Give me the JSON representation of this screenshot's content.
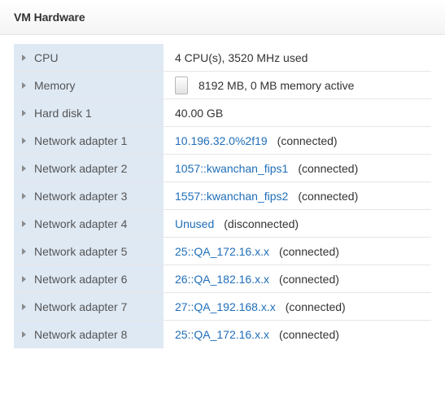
{
  "panel": {
    "title": "VM Hardware"
  },
  "rows": [
    {
      "label": "CPU",
      "value": "4 CPU(s), 3520 MHz used"
    },
    {
      "label": "Memory",
      "value": "8192 MB, 0 MB memory active",
      "memory_active_fraction": 0
    },
    {
      "label": "Hard disk 1",
      "value": "40.00 GB"
    },
    {
      "label": "Network adapter 1",
      "network": "10.196.32.0%2f19",
      "status": "(connected)"
    },
    {
      "label": "Network adapter 2",
      "network": "1057::kwanchan_fips1",
      "status": "(connected)"
    },
    {
      "label": "Network adapter 3",
      "network": "1557::kwanchan_fips2",
      "status": "(connected)"
    },
    {
      "label": "Network adapter 4",
      "network": "Unused",
      "status": "(disconnected)"
    },
    {
      "label": "Network adapter 5",
      "network": "25::QA_172.16.x.x",
      "status": "(connected)"
    },
    {
      "label": "Network adapter 6",
      "network": "26::QA_182.16.x.x",
      "status": "(connected)"
    },
    {
      "label": "Network adapter 7",
      "network": "27::QA_192.168.x.x",
      "status": "(connected)"
    },
    {
      "label": "Network adapter 8",
      "network": "25::QA_172.16.x.x",
      "status": "(connected)"
    }
  ],
  "colors": {
    "label_bg": "#dfe9f4",
    "link": "#1f6eb9"
  },
  "icons": {
    "expand": "expand-caret-icon",
    "memory": "memory-bar-icon"
  }
}
